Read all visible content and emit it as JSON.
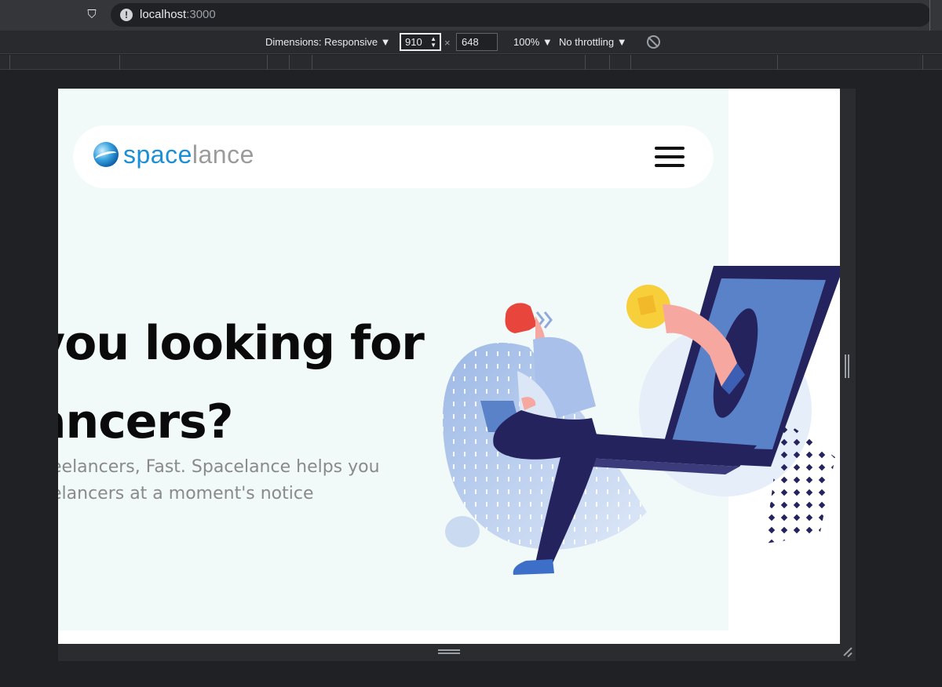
{
  "browser": {
    "url_host": "localhost",
    "url_port": ":3000"
  },
  "devtools": {
    "dimensions_label": "Dimensions: Responsive ▼",
    "width_value": "910",
    "height_value": "648",
    "times": "×",
    "zoom_label": "100% ▼",
    "throttle_label": "No throttling ▼"
  },
  "page": {
    "logo_part1": "space",
    "logo_part2": "lance",
    "headline_line1": "you looking for",
    "headline_line2": "ancers?",
    "subtitle_line1": "eelancers, Fast. Spacelance helps you",
    "subtitle_line2": "elancers at a moment's notice"
  },
  "colors": {
    "hero_bg": "#f1f9f9",
    "brand_blue": "#1a8fd8",
    "brand_gray": "#9b9b9b",
    "illustration_navy": "#25235e",
    "illustration_blue": "#5a82c8",
    "coin_yellow": "#f6cf3a",
    "hair_red": "#e8463c"
  }
}
